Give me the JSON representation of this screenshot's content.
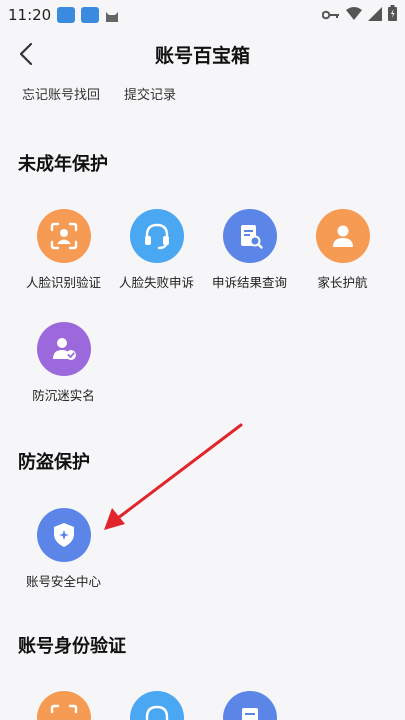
{
  "status": {
    "time": "11:20"
  },
  "header": {
    "title": "账号百宝箱"
  },
  "links": [
    {
      "label": "忘记账号找回"
    },
    {
      "label": "提交记录"
    }
  ],
  "sections": {
    "minor": {
      "title": "未成年保护",
      "items": [
        {
          "label": "人脸识别验证",
          "icon": "face-scan-icon",
          "color": "#f59b54"
        },
        {
          "label": "人脸失败申诉",
          "icon": "headset-icon",
          "color": "#4aa7f2"
        },
        {
          "label": "申诉结果查询",
          "icon": "document-search-icon",
          "color": "#5b86e8"
        },
        {
          "label": "家长护航",
          "icon": "parent-user-icon",
          "color": "#f59b54"
        },
        {
          "label": "防沉迷实名",
          "icon": "verified-user-icon",
          "color": "#9b69db"
        }
      ]
    },
    "theft": {
      "title": "防盗保护",
      "items": [
        {
          "label": "账号安全中心",
          "icon": "shield-icon",
          "color": "#5b86e8"
        }
      ]
    },
    "identity": {
      "title": "账号身份验证",
      "items": [
        {
          "label": "",
          "icon": "face-scan-icon",
          "color": "#f59b54"
        },
        {
          "label": "",
          "icon": "headset-icon",
          "color": "#4aa7f2"
        },
        {
          "label": "",
          "icon": "document-icon",
          "color": "#5b86e8"
        }
      ]
    }
  },
  "annotation": {
    "arrow_color": "#e0262c"
  }
}
